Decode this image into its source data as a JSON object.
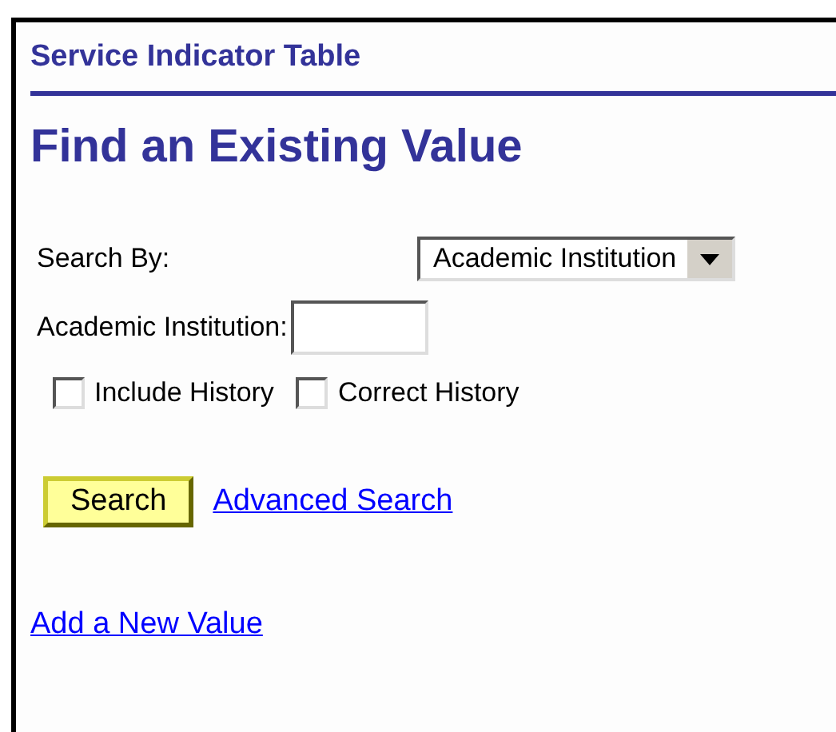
{
  "page_title": "Service Indicator Table",
  "heading": "Find an Existing Value",
  "search_by": {
    "label": "Search By:",
    "value": "Academic Institution"
  },
  "field": {
    "label": "Academic Institution:"
  },
  "checkboxes": [
    {
      "label": "Include History",
      "checked": false
    },
    {
      "label": "Correct History",
      "checked": false
    }
  ],
  "search_button": "Search",
  "advanced_link": "Advanced Search",
  "add_link": "Add a New Value"
}
